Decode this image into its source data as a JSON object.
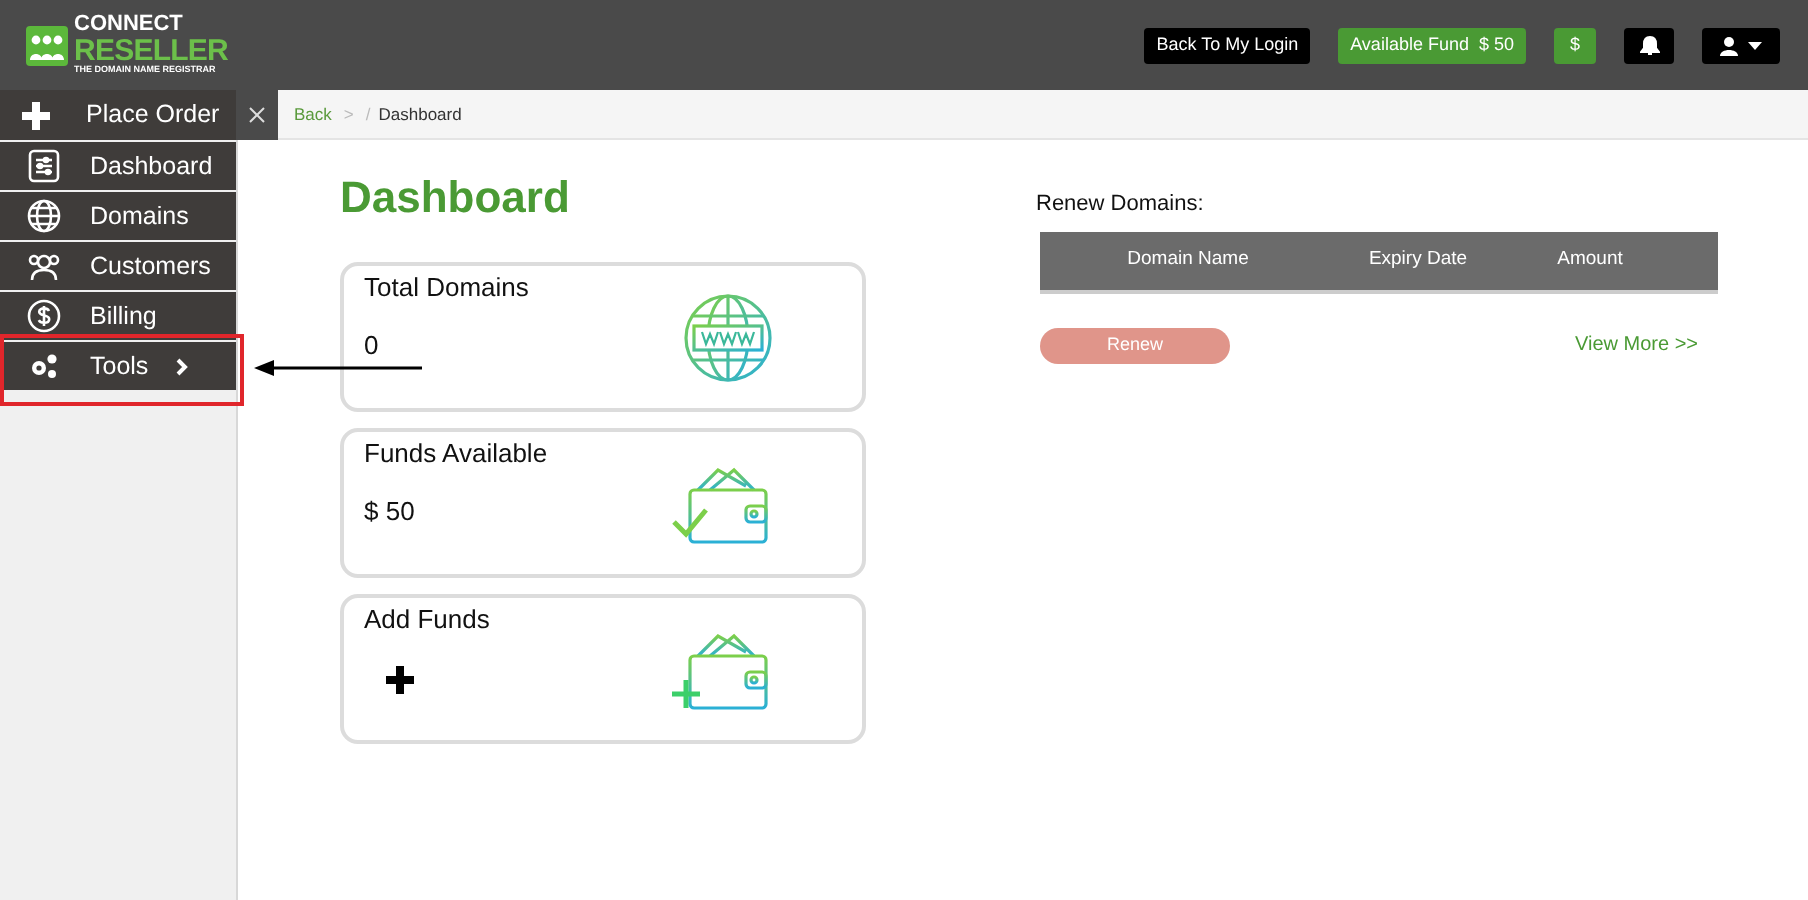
{
  "logo": {
    "line1": "CONNECT",
    "line2": "RESELLER",
    "tagline": "THE DOMAIN NAME REGISTRAR"
  },
  "header": {
    "login_button": "Back To My Login",
    "fund_label": "Available Fund",
    "fund_amount": "$ 50",
    "dollar_button": "$"
  },
  "sidebar": {
    "place_order": "Place Order",
    "items": [
      {
        "label": "Dashboard",
        "expandable": false
      },
      {
        "label": "Domains",
        "expandable": false
      },
      {
        "label": "Customers",
        "expandable": false
      },
      {
        "label": "Billing",
        "expandable": false
      },
      {
        "label": "Tools",
        "expandable": true
      }
    ]
  },
  "breadcrumb": {
    "back": "Back",
    "separators": [
      ">",
      "/"
    ],
    "current": "Dashboard"
  },
  "page_title": "Dashboard",
  "cards": [
    {
      "title": "Total Domains",
      "value": "0",
      "kind": "text"
    },
    {
      "title": "Funds Available",
      "value": "$ 50",
      "kind": "text"
    },
    {
      "title": "Add Funds",
      "kind": "add"
    }
  ],
  "renew": {
    "title": "Renew Domains:",
    "columns": [
      "Domain Name",
      "Expiry Date",
      "Amount"
    ],
    "button": "Renew",
    "link": "View More >>"
  }
}
